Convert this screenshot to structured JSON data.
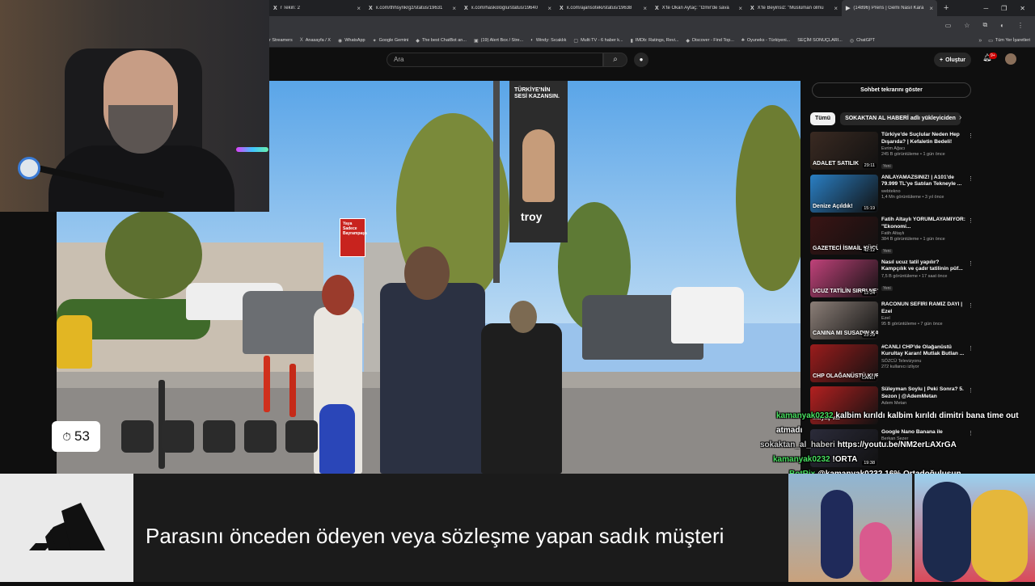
{
  "browser": {
    "tabs": [
      {
        "favicon": "X",
        "title": "r Tekin: 2"
      },
      {
        "favicon": "X",
        "title": "x.com/thhsynkrgz/status/19631"
      },
      {
        "favicon": "X",
        "title": "x.com/haskologlu/status/19640"
      },
      {
        "favicon": "X",
        "title": "x.com/ajansoteki/status/19638"
      },
      {
        "favicon": "X",
        "title": "X'te Okan Aytaç: \"İzmir'de sava"
      },
      {
        "favicon": "X",
        "title": "X'te Beyinsiz: \"Müslüman olmu"
      },
      {
        "favicon": "▶",
        "title": "(14896) Prens | Gemi Nasıl Kara"
      }
    ],
    "new_tab": "+",
    "bookmarks": [
      {
        "icon": "",
        "label": "r Streamers"
      },
      {
        "icon": "X",
        "label": "Anasayfa / X"
      },
      {
        "icon": "◉",
        "label": "WhatsApp"
      },
      {
        "icon": "✦",
        "label": "Google Gemini"
      },
      {
        "icon": "◆",
        "label": "The best ChatBot an..."
      },
      {
        "icon": "▣",
        "label": "(19) Alert Box / Stre..."
      },
      {
        "icon": "◐",
        "label": "Windy: Sıcaklık"
      },
      {
        "icon": "▢",
        "label": "Multi TV - 6 haber k..."
      },
      {
        "icon": "▮",
        "label": "IMDb: Ratings, Revi..."
      },
      {
        "icon": "◆",
        "label": "Discover - Find Top..."
      },
      {
        "icon": "♣",
        "label": "Oyuneks - Türkiyeni..."
      },
      {
        "icon": "",
        "label": "SEÇİM SONUÇLARI..."
      },
      {
        "icon": "◎",
        "label": "ChatGPT"
      }
    ],
    "bookmarks_more": "»",
    "all_bookmarks": "Tüm Yer İşaretleri"
  },
  "youtube": {
    "search_placeholder": "Ara",
    "create_label": "Oluştur",
    "notification_count": "9+",
    "chat_toggle": "Sohbet tekrarını göster",
    "chips": [
      "Tümü",
      "SOKAKTAN AL HABERİ adlı yükleyiciden"
    ],
    "recommendations": [
      {
        "thumb_label": "ADALET SATILIK",
        "duration": "29:11",
        "title": "Türkiye'de Suçlular Neden Hep Dışarıda? | Kefaletin Bedeli!",
        "channel": "Evrim Ağacı",
        "meta": "245 B görüntüleme • 1 gün önce",
        "badge": "Yeni",
        "thumb_color": "#3a2a22"
      },
      {
        "thumb_label": "Denize Açıldık!",
        "duration": "15:19",
        "title": "ANLAYAMAZSINIZ! | A101'de 79.999 TL'ye Satılan Tekneyle ...",
        "channel": "webtekno",
        "meta": "1,4 Mn görüntüleme • 3 yıl önce",
        "badge": "",
        "thumb_color": "#2a7fc4"
      },
      {
        "thumb_label": "GAZETECİ İSMAİL KÜÇÜKKAYA",
        "duration": "42:12",
        "title": "Fatih Altaylı YORUMLAYAMIYOR: \"Ekonomi...",
        "channel": "Fatih Altaylı",
        "meta": "384 B görüntüleme • 1 gün önce",
        "badge": "Yeni",
        "thumb_color": "#3a1414"
      },
      {
        "thumb_label": "UCUZ TATİLİN SIRRI NE?",
        "duration": "12:24",
        "title": "Nasıl ucuz tatil yapılır? Kampçılık ve çadır tatilinin püf...",
        "channel": "",
        "meta": "7,5 B görüntüleme • 17 saat önce",
        "badge": "Yeni",
        "thumb_color": "#c0427a"
      },
      {
        "thumb_label": "CANINA MI SUSADIN KARDEŞ?",
        "duration": "23:29",
        "title": "RACONUN SEFİRİ RAMİZ DAYI | Ezel",
        "channel": "Ezel",
        "meta": "95 B görüntüleme • 7 gün önce",
        "badge": "",
        "thumb_color": "#8c7f78"
      },
      {
        "thumb_label": "CHP OLAĞANÜSTÜ KURULTAYA",
        "duration": "CANLI",
        "title": "#CANLI CHP'de Olağanüstü Kurultay Kararı! Mutlak Butlan ...",
        "channel": "SÖZCÜ Televizyonu",
        "meta": "272 kullanıcı izliyor",
        "badge": "",
        "thumb_color": "#9b1c1c"
      },
      {
        "thumb_label": "ihtiyaç var",
        "duration": "",
        "title": "Süleyman Soylu | Peki Sonra? 5. Sezon | @AdemMetan",
        "channel": "Adem Metan",
        "meta": "",
        "badge": "",
        "thumb_color": "#b32020"
      },
      {
        "thumb_label": "",
        "duration": "19:38",
        "title": "Google Nano Banana ile",
        "channel": "Berkan Sezer",
        "meta": "4,9 B görüntüleme • 3 gün önce",
        "badge": "",
        "thumb_color": "#2b2b3a"
      }
    ]
  },
  "video": {
    "billboard_text": "TÜRKİYE'NİN SESİ KAZANSIN.",
    "billboard_brand": "troy",
    "street_sign": "Yaya Sadece Bayrampaşa"
  },
  "stream": {
    "timer_value": "53",
    "chat": [
      {
        "user": "kamanyak0232",
        "color": "green",
        "text": "kalbim kırıldı kalbim kırıldı dimitri bana time out atmadı"
      },
      {
        "user": "sokaktan_al_haberi",
        "color": "gray",
        "text": "https://youtu.be/NM2erLAXrGA"
      },
      {
        "user": "kamanyak0232",
        "color": "green",
        "text": "!ORTA"
      },
      {
        "user": "BotRix",
        "color": "green",
        "text": "@kamanyak0232 16% Ortadoğuluşun"
      }
    ]
  },
  "ad": {
    "text": "Parasını önceden ödeyen veya sözleşme yapan sadık müşteri",
    "brand": "adidas"
  },
  "colors": {
    "yt_bg": "#0f0f0f",
    "chat_green": "#48e060",
    "chat_gray": "#c9c9c9",
    "ad_bg": "#1b1b1b"
  }
}
